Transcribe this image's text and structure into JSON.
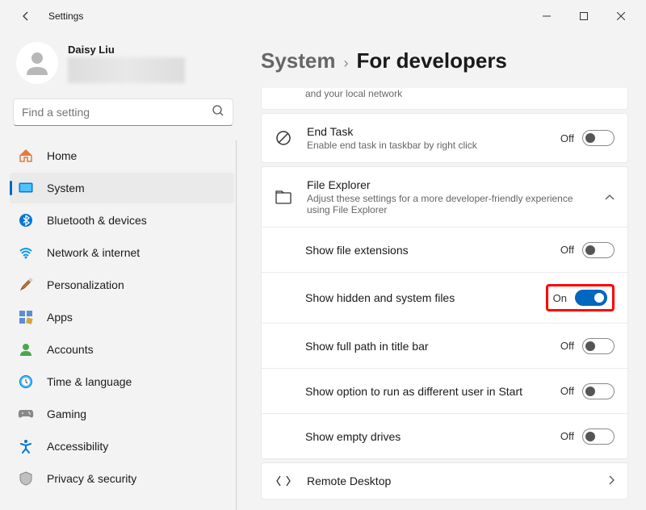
{
  "app_title": "Settings",
  "profile": {
    "name": "Daisy Liu"
  },
  "search": {
    "placeholder": "Find a setting"
  },
  "nav": {
    "home": "Home",
    "system": "System",
    "bluetooth": "Bluetooth & devices",
    "network": "Network & internet",
    "personalization": "Personalization",
    "apps": "Apps",
    "accounts": "Accounts",
    "time": "Time & language",
    "gaming": "Gaming",
    "accessibility": "Accessibility",
    "privacy": "Privacy & security"
  },
  "breadcrumb": {
    "parent": "System",
    "current": "For developers"
  },
  "truncated_desc": "and your local network",
  "end_task": {
    "title": "End Task",
    "desc": "Enable end task in taskbar by right click",
    "state": "Off"
  },
  "file_explorer": {
    "title": "File Explorer",
    "desc": "Adjust these settings for a more developer-friendly experience using File Explorer",
    "rows": {
      "ext": {
        "label": "Show file extensions",
        "state": "Off"
      },
      "hidden": {
        "label": "Show hidden and system files",
        "state": "On"
      },
      "fullpath": {
        "label": "Show full path in title bar",
        "state": "Off"
      },
      "runas": {
        "label": "Show option to run as different user in Start",
        "state": "Off"
      },
      "empty": {
        "label": "Show empty drives",
        "state": "Off"
      }
    }
  },
  "remote_desktop": {
    "title": "Remote Desktop"
  }
}
